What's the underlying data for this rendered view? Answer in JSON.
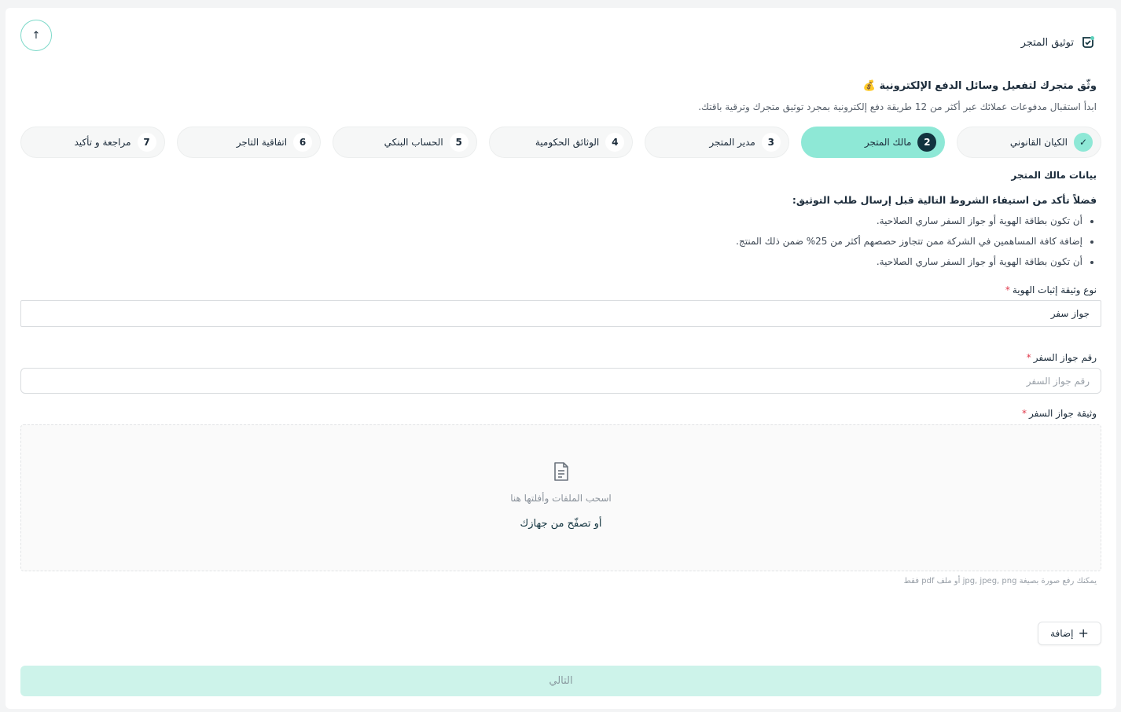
{
  "header": {
    "title": "توثيق المتجر",
    "collapse_icon": "arrow-up-icon"
  },
  "intro": {
    "headline": "وثّق متجرك لتفعيل وسائل الدفع الإلكترونية 💰",
    "subline": "ابدأ استقبال مدفوعات عملائك عبر أكثر من 12 طريقة دفع إلكترونية بمجرد توثيق متجرك وترقية باقتك."
  },
  "steps": [
    {
      "num": "✓",
      "label": "الكيان القانوني",
      "state": "done"
    },
    {
      "num": "2",
      "label": "مالك المتجر",
      "state": "active"
    },
    {
      "num": "3",
      "label": "مدير المتجر",
      "state": "pending"
    },
    {
      "num": "4",
      "label": "الوثائق الحكومية",
      "state": "pending"
    },
    {
      "num": "5",
      "label": "الحساب البنكي",
      "state": "pending"
    },
    {
      "num": "6",
      "label": "اتفاقية التاجر",
      "state": "pending"
    },
    {
      "num": "7",
      "label": "مراجعة و تأكيد",
      "state": "pending"
    }
  ],
  "section": {
    "title": "بيانات مالك المتجر",
    "conditions_title": "فضلاً تأكد من استيفاء الشروط التالية قبل إرسال طلب التوثيق:",
    "conditions": [
      "أن تكون بطاقة الهوية أو جواز السفر ساري الصلاحية.",
      "إضافة كافة المساهمين في الشركة ممن تتجاوز حصصهم أكثر من 25% ضمن ذلك المنتج.",
      "أن تكون بطاقة الهوية أو جواز السفر ساري الصلاحية."
    ]
  },
  "form": {
    "id_type_label": "نوع وثيقة إثبات الهوية",
    "id_type_value": "جواز سفر",
    "passport_number_label": "رقم جواز السفر",
    "passport_number_placeholder": "رقم جواز السفر",
    "passport_number_value": "",
    "passport_doc_label": "وثيقة جواز السفر",
    "required_mark": "*",
    "dropzone_text": "اسحب الملفات وأفلتها هنا",
    "browse_text": "أو تصفّح من جهازك",
    "hint": "يمكنك رفع صورة بصيغة jpg, jpeg, png أو ملف pdf فقط",
    "add_label": "إضافة",
    "next_label": "التالي"
  },
  "colors": {
    "accent": "#8ee8d6",
    "active_num_bg": "#12343f",
    "next_disabled_bg": "#cdf3ea",
    "required": "#e0384b"
  }
}
